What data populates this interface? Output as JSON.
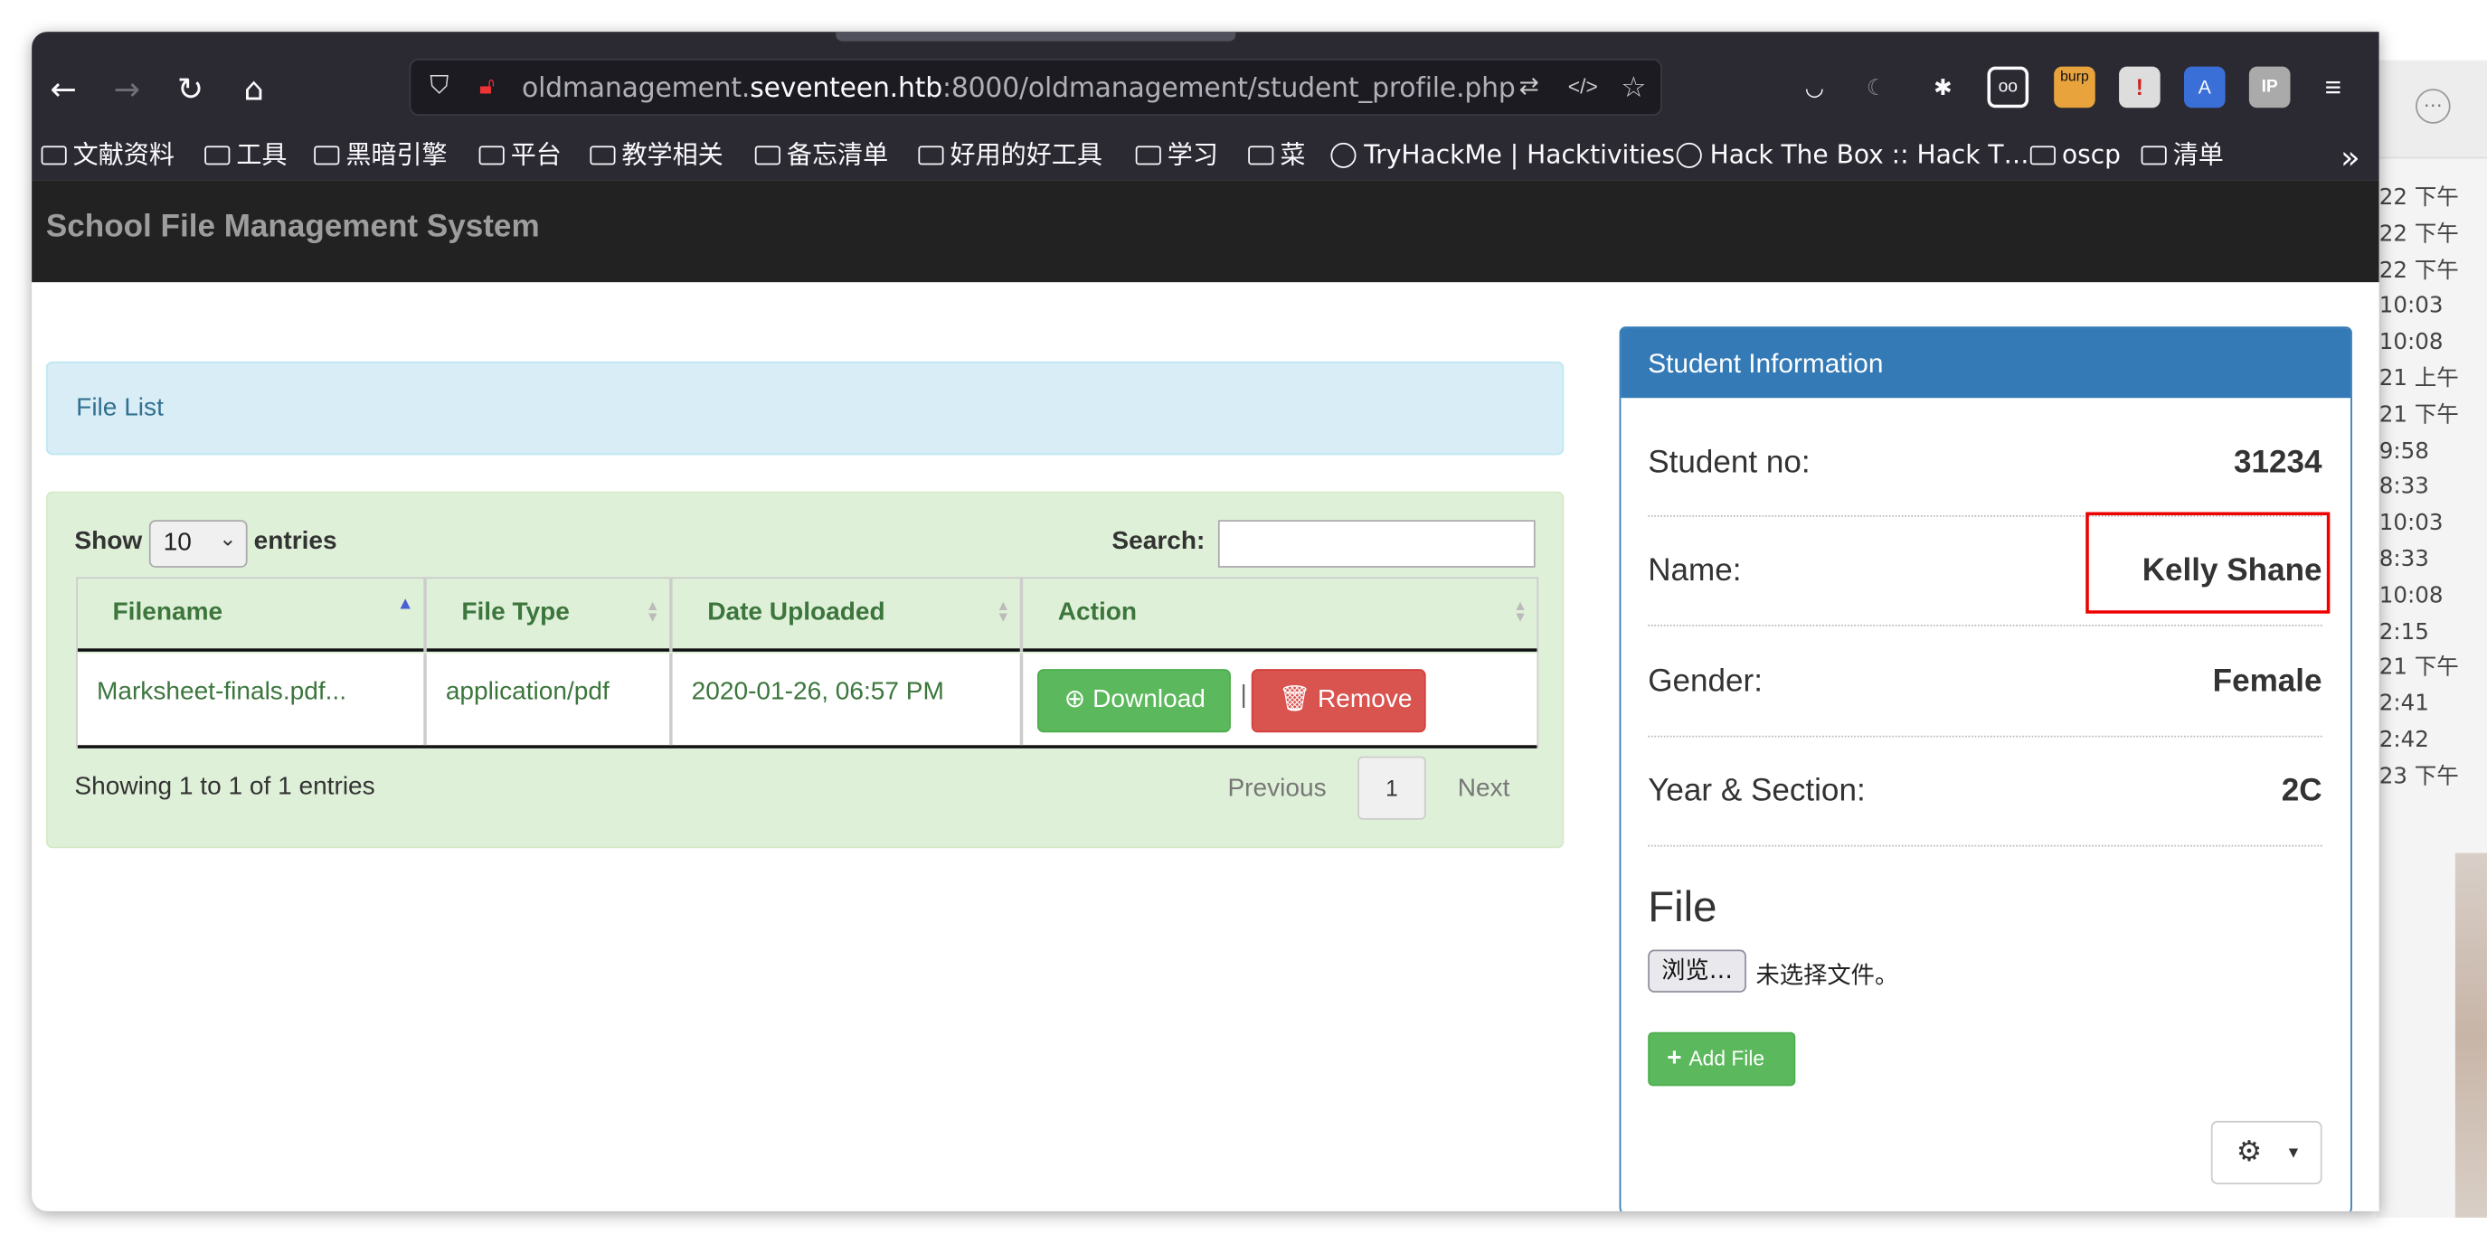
{
  "browser": {
    "url_prefix": "oldmanagement.",
    "url_host": "seventeen.htb",
    "url_rest": ":8000/oldmanagement/student_profile.php",
    "extension_badge": "burp",
    "bookmarks": [
      "文献资料",
      "工具",
      "黑暗引擎",
      "平台",
      "教学相关",
      "备忘清单",
      "好用的好工具",
      "学习",
      "菜",
      "TryHackMe | Hacktivities",
      "Hack The Box :: Hack T…",
      "oscp",
      "清单"
    ]
  },
  "background_window": {
    "times": [
      "22 下午",
      "22 下午",
      "22 下午",
      "10:03",
      "10:08",
      "21 上午",
      "21 下午",
      "9:58",
      "8:33",
      "10:03",
      "8:33",
      "10:08",
      "2:15",
      "21 下午",
      "2:41",
      "2:42",
      "23 下午"
    ]
  },
  "site": {
    "brand": "School File Management System",
    "file_list_title": "File List",
    "table": {
      "show_label": "Show",
      "page_length": "10",
      "entries_label": "entries",
      "search_label": "Search:",
      "columns": [
        "Filename",
        "File Type",
        "Date Uploaded",
        "Action"
      ],
      "rows": [
        {
          "filename": "Marksheet-finals.pdf...",
          "file_type": "application/pdf",
          "date_uploaded": "2020-01-26, 06:57 PM",
          "download_label": "Download",
          "remove_label": "Remove"
        }
      ],
      "info": "Showing 1 to 1 of 1 entries",
      "previous_label": "Previous",
      "current_page": "1",
      "next_label": "Next"
    },
    "student": {
      "panel_title": "Student Information",
      "student_no_label": "Student no:",
      "student_no": "31234",
      "name_label": "Name:",
      "name": "Kelly Shane",
      "gender_label": "Gender:",
      "gender": "Female",
      "year_section_label": "Year & Section:",
      "year_section": "2C",
      "file_heading": "File",
      "browse_label": "浏览…",
      "no_file_label": "未选择文件。",
      "add_file_label": "Add File"
    }
  },
  "colors": {
    "navbar": "#222222",
    "primary": "#337ab7",
    "success": "#5cb85c",
    "danger": "#d9534f",
    "highlight": "#e00000"
  }
}
